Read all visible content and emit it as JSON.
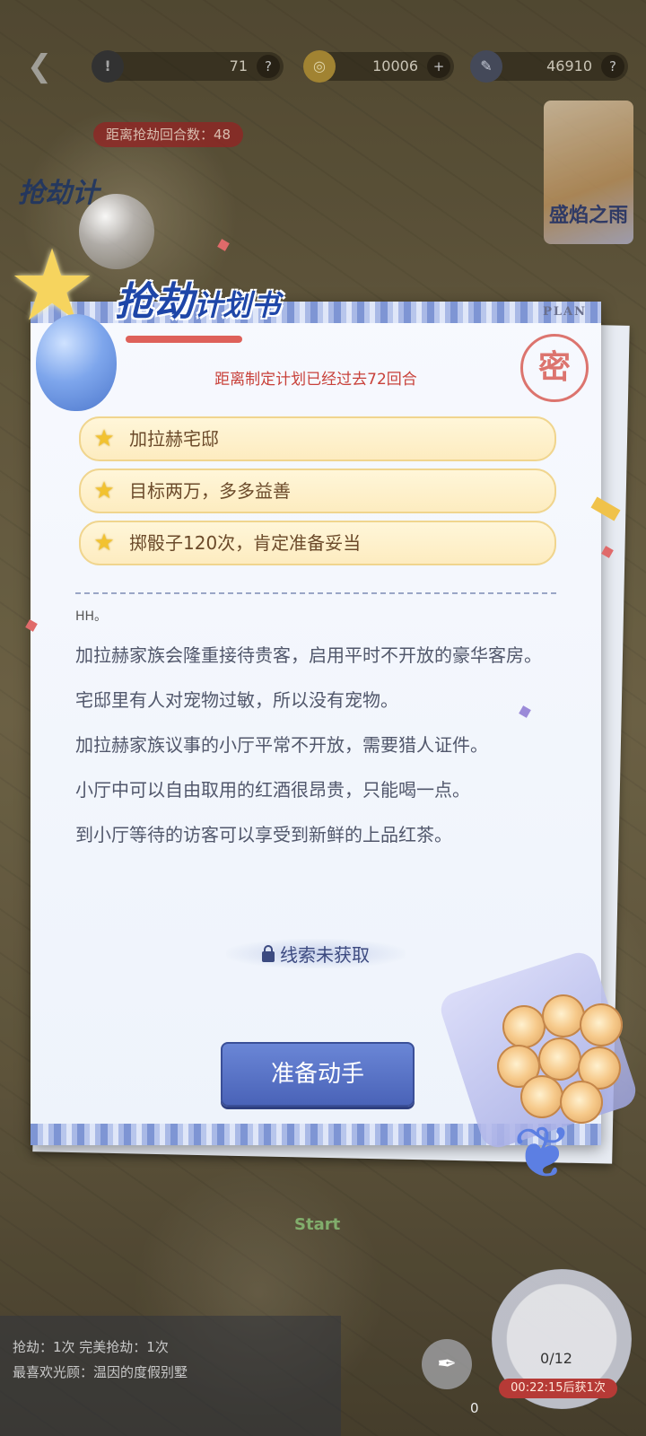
{
  "topbar": {
    "resources": [
      {
        "icon": "warning-icon",
        "value": "71",
        "button": "?"
      },
      {
        "icon": "coin-icon",
        "value": "10006",
        "button": "+"
      },
      {
        "icon": "feather-icon",
        "value": "46910",
        "button": "?"
      }
    ]
  },
  "round_badge": "距离抢劫回合数：48",
  "side_title": "抢劫计",
  "event_logo": "盛焰之雨",
  "card": {
    "plan_tag": "PLAN",
    "title_main": "抢劫",
    "title_sub": "计划书",
    "elapsed": "距离制定计划已经过去72回合",
    "stamp": "密",
    "goals": [
      {
        "text": "加拉赫宅邸"
      },
      {
        "text": "目标两万，多多益善"
      },
      {
        "text": "掷骰子120次，肯定准备妥当"
      }
    ],
    "clue_header": "HH。",
    "clues": [
      "加拉赫家族会隆重接待贵客，启用平时不开放的豪华客房。",
      "宅邸里有人对宠物过敏，所以没有宠物。",
      "加拉赫家族议事的小厅平常不开放，需要猎人证件。",
      "小厅中可以自由取用的红酒很昂贵，只能喝一点。",
      "到小厅等待的访客可以享受到新鲜的上品红茶。"
    ],
    "locked_clue": "线索未获取",
    "action_button": "准备动手"
  },
  "map": {
    "start_label": "Start"
  },
  "bottom": {
    "stats_line1": "抢劫：1次  完美抢劫：1次",
    "stats_line2": "最喜欢光顾：温因的度假别墅",
    "quill_count": "0",
    "dice_count": "0/12",
    "timer": "00:22:15后获1次"
  }
}
